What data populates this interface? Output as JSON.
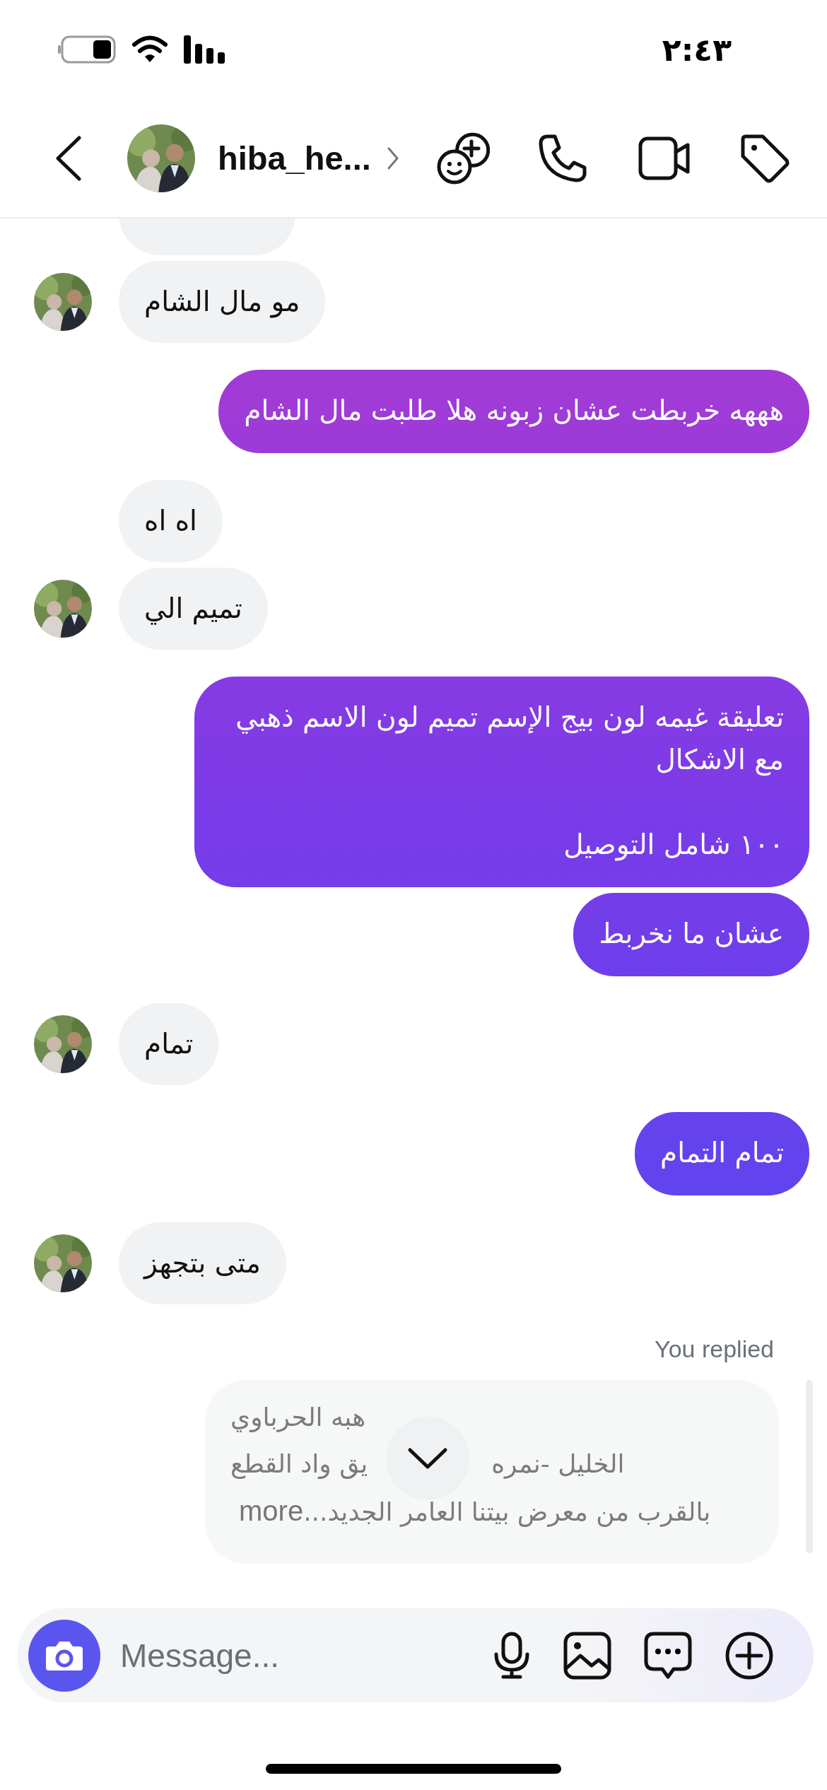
{
  "status_bar": {
    "time": "٢:٤٣"
  },
  "header": {
    "username": "hiba_he..."
  },
  "messages": [
    {
      "kind": "incoming",
      "avatar": false
    },
    {
      "kind": "incoming",
      "text": "مو مال الشام",
      "avatar": true
    },
    {
      "kind": "outgoing",
      "text": "هههه خربطت عشان زبونه هلا طلبت مال الشام"
    },
    {
      "kind": "incoming",
      "text": "اه اه",
      "avatar": false
    },
    {
      "kind": "incoming",
      "text": "تميم الي",
      "avatar": true
    },
    {
      "kind": "outgoing",
      "text": "تعليقة غيمه لون بيج الإسم تميم لون الاسم ذهبي مع الاشكال\n\n١٠٠ شامل التوصيل"
    },
    {
      "kind": "outgoing",
      "text": "عشان ما نخربط"
    },
    {
      "kind": "incoming",
      "text": "تمام",
      "avatar": true
    },
    {
      "kind": "outgoing",
      "text": "تمام التمام"
    },
    {
      "kind": "incoming",
      "text": "متى بتجهز",
      "avatar": true
    }
  ],
  "reply": {
    "label": "You replied",
    "sender": "هبه الحرباوي",
    "line_right": "الخليل -نمره",
    "line_left": "يق واد القطع",
    "line_last": "بالقرب من معرض بيتنا العامر الجديد...",
    "more": "more"
  },
  "composer": {
    "placeholder": "Message..."
  }
}
